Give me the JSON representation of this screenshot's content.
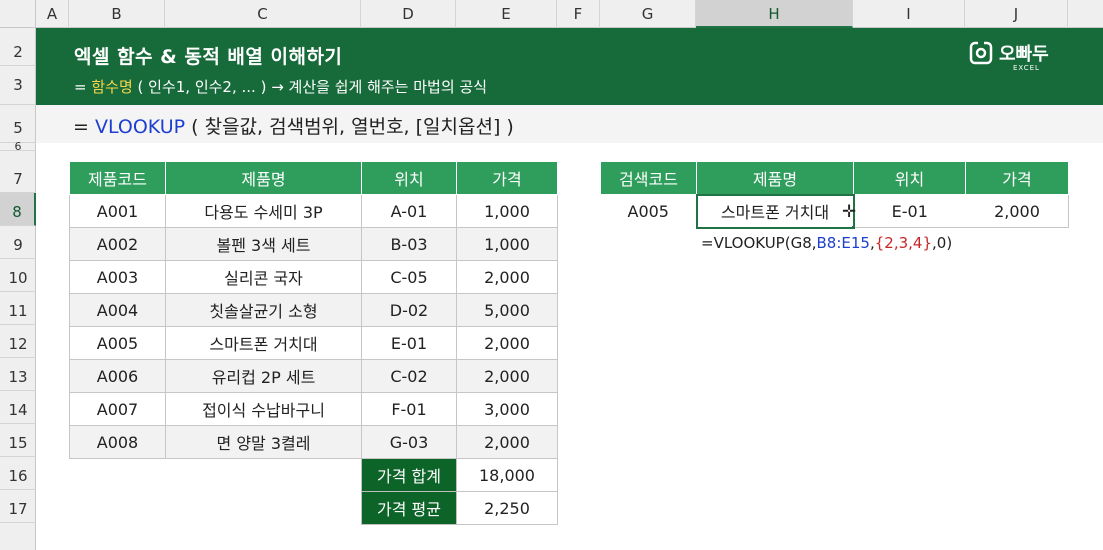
{
  "columns": [
    "A",
    "B",
    "C",
    "D",
    "E",
    "F",
    "G",
    "H",
    "I",
    "J"
  ],
  "rows": [
    "2",
    "3",
    "5",
    "6",
    "7",
    "8",
    "9",
    "10",
    "11",
    "12",
    "13",
    "14",
    "15",
    "16",
    "17"
  ],
  "banner": {
    "title": "엑셀 함수 & 동적 배열 이해하기",
    "sub_prefix": "= ",
    "sub_highlight": "함수명",
    "sub_rest": " ( 인수1, 인수2, ... )   → 계산을 쉽게 해주는 마법의 공식",
    "logo_name": "오빠두",
    "logo_sub": "EXCEL"
  },
  "syntax": {
    "prefix": "=  ",
    "fn": "VLOOKUP",
    "args": " ( 찾을값, 검색범위, 열번호, [일치옵션] )"
  },
  "product_table": {
    "headers": [
      "제품코드",
      "제품명",
      "위치",
      "가격"
    ],
    "rows": [
      [
        "A001",
        "다용도 수세미 3P",
        "A-01",
        "1,000"
      ],
      [
        "A002",
        "볼펜 3색 세트",
        "B-03",
        "1,000"
      ],
      [
        "A003",
        "실리콘 국자",
        "C-05",
        "2,000"
      ],
      [
        "A004",
        "칫솔살균기 소형",
        "D-02",
        "5,000"
      ],
      [
        "A005",
        "스마트폰 거치대",
        "E-01",
        "2,000"
      ],
      [
        "A006",
        "유리컵 2P 세트",
        "C-02",
        "2,000"
      ],
      [
        "A007",
        "접이식 수납바구니",
        "F-01",
        "3,000"
      ],
      [
        "A008",
        "면 양말 3켤레",
        "G-03",
        "2,000"
      ]
    ],
    "sum_label": "가격 합계",
    "sum_value": "18,000",
    "avg_label": "가격 평균",
    "avg_value": "2,250"
  },
  "lookup_table": {
    "headers": [
      "검색코드",
      "제품명",
      "위치",
      "가격"
    ],
    "row": [
      "A005",
      "스마트폰 거치대",
      "E-01",
      "2,000"
    ]
  },
  "formula": {
    "p1": "=VLOOKUP(G8,",
    "p2": "B8:E15",
    "p3": ",",
    "p4": "{2,3,4}",
    "p5": ",0)"
  },
  "selection": {
    "cell": "H8",
    "column": "H",
    "row": "8"
  },
  "colors": {
    "banner": "#176b3a",
    "header": "#2f9d5c",
    "summary": "#0d6428",
    "function": "#1d3fd1",
    "array": "#c62828",
    "highlight": "#f7d54a"
  }
}
